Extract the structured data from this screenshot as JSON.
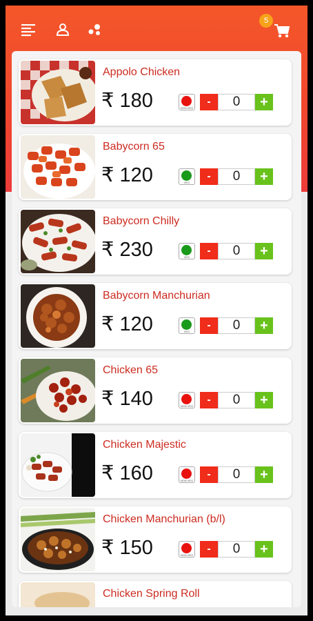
{
  "header": {
    "menu_icon": "menu-icon",
    "profile_icon": "user-icon",
    "share_icon": "share-icon",
    "cart_icon": "cart-icon",
    "cart_count": "5"
  },
  "colors": {
    "header_gradient_top": "#f4572a",
    "header_gradient_bottom": "#ec3c3a",
    "item_name": "#cc2b20",
    "minus_button": "#f02c1a",
    "plus_button": "#69c21b",
    "non_veg": "#e8120e",
    "veg": "#1a9a1a"
  },
  "menu": {
    "items": [
      {
        "name": "Appolo Chicken",
        "price": "₹ 180",
        "qty": "0",
        "diet": "non-veg",
        "diet_label": "NON VEG",
        "minus": "-",
        "plus": "+"
      },
      {
        "name": "Babycorn 65",
        "price": "₹ 120",
        "qty": "0",
        "diet": "veg",
        "diet_label": "VEG",
        "minus": "-",
        "plus": "+"
      },
      {
        "name": "Babycorn Chilly",
        "price": "₹ 230",
        "qty": "0",
        "diet": "veg",
        "diet_label": "VEG",
        "minus": "-",
        "plus": "+"
      },
      {
        "name": "Babycorn Manchurian",
        "price": "₹ 120",
        "qty": "0",
        "diet": "veg",
        "diet_label": "VEG",
        "minus": "-",
        "plus": "+"
      },
      {
        "name": "Chicken 65",
        "price": "₹ 140",
        "qty": "0",
        "diet": "non-veg",
        "diet_label": "NON VEG",
        "minus": "-",
        "plus": "+"
      },
      {
        "name": "Chicken Majestic",
        "price": "₹ 160",
        "qty": "0",
        "diet": "non-veg",
        "diet_label": "NON VEG",
        "minus": "-",
        "plus": "+"
      },
      {
        "name": "Chicken Manchurian (b/l)",
        "price": "₹ 150",
        "qty": "0",
        "diet": "non-veg",
        "diet_label": "NON VEG",
        "minus": "-",
        "plus": "+"
      },
      {
        "name": "Chicken Spring Roll",
        "price": "",
        "qty": "",
        "diet": "",
        "diet_label": "",
        "minus": "",
        "plus": ""
      }
    ]
  }
}
